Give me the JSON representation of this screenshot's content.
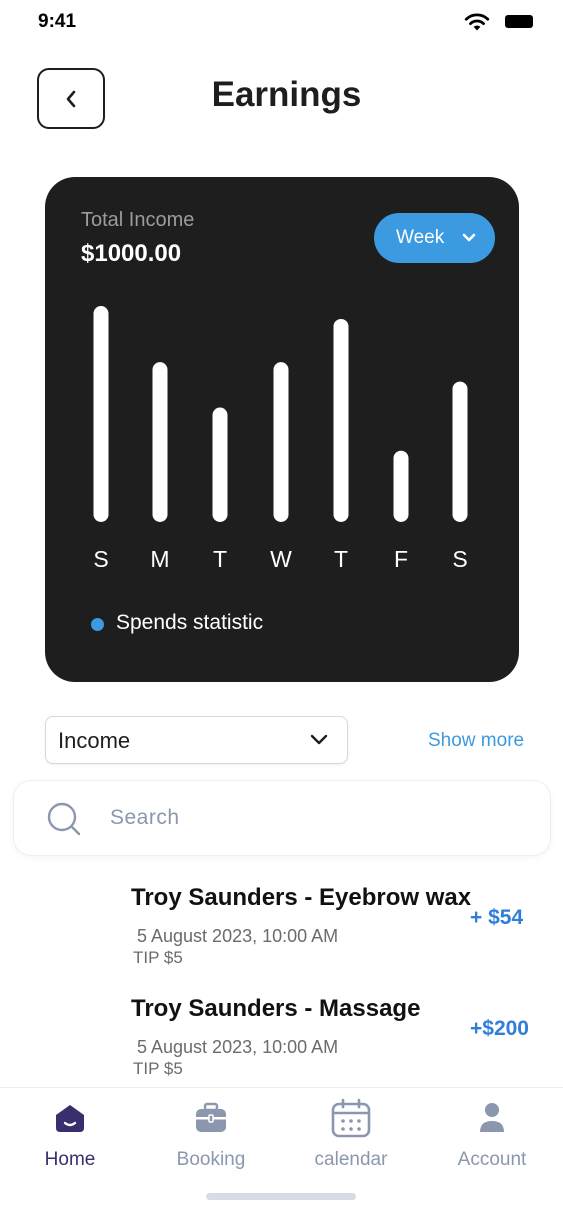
{
  "status_bar": {
    "time": "9:41"
  },
  "header": {
    "title": "Earnings"
  },
  "income_card": {
    "label": "Total Income",
    "amount": "$1000.00",
    "period_button": "Week",
    "legend": "Spends statistic"
  },
  "chart_data": {
    "type": "bar",
    "categories": [
      "S",
      "M",
      "T",
      "W",
      "T",
      "F",
      "S"
    ],
    "series": [
      {
        "name": "Spends statistic",
        "values": [
          100,
          74,
          53,
          74,
          94,
          33,
          65
        ]
      }
    ],
    "ylim": [
      0,
      100
    ],
    "title": "",
    "xlabel": "",
    "ylabel": "",
    "grid": false,
    "legend_position": "bottom-left"
  },
  "filter": {
    "selected": "Income",
    "show_more": "Show more"
  },
  "search": {
    "placeholder": "Search"
  },
  "transactions": [
    {
      "title": "Troy Saunders - Eyebrow wax",
      "amount": "+ $54",
      "date": "5 August 2023, 10:00 AM",
      "tip": "TIP $5"
    },
    {
      "title": "Troy Saunders - Massage",
      "amount": "+$200",
      "date": "5 August 2023, 10:00 AM",
      "tip": "TIP $5"
    }
  ],
  "nav": {
    "items": [
      {
        "label": "Home",
        "icon": "home-icon",
        "active": true
      },
      {
        "label": "Booking",
        "icon": "briefcase-icon",
        "active": false
      },
      {
        "label": "calendar",
        "icon": "calendar-icon",
        "active": false
      },
      {
        "label": "Account",
        "icon": "user-icon",
        "active": false
      }
    ]
  },
  "colors": {
    "accent": "#3b9ae0",
    "amount": "#2f7ed8",
    "card": "#1e1e1e",
    "nav_active": "#3a2f6e",
    "nav_inactive": "#8a97ae"
  }
}
